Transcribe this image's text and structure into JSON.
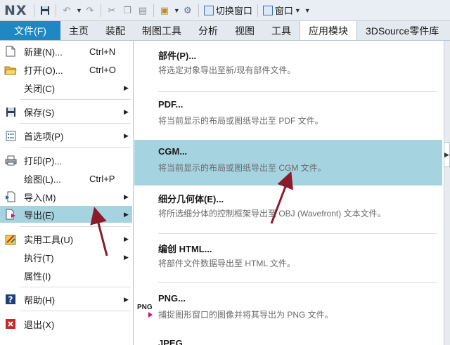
{
  "app": {
    "logo": "NX"
  },
  "quick_access": {
    "switch_window_label": "切换窗口",
    "window_label": "窗口",
    "icons": [
      "save-icon",
      "undo-icon",
      "redo-icon",
      "cut-icon",
      "copy-icon",
      "paste-icon",
      "touch-mode-icon",
      "repeat-command-icon"
    ]
  },
  "tabs": {
    "file": "文件(F)",
    "items": [
      "主页",
      "装配",
      "制图工具",
      "分析",
      "视图",
      "工具",
      "应用模块",
      "3DSource零件库"
    ],
    "active": "应用模块"
  },
  "left_menu": {
    "items": [
      {
        "label": "新建(N)...",
        "shortcut": "Ctrl+N",
        "icon": "new-icon",
        "arrow": false
      },
      {
        "label": "打开(O)...",
        "shortcut": "Ctrl+O",
        "icon": "open-folder-icon",
        "arrow": false
      },
      {
        "label": "关闭(C)",
        "shortcut": "",
        "icon": "",
        "arrow": true
      },
      {
        "label": "保存(S)",
        "shortcut": "",
        "icon": "save-icon",
        "arrow": true
      },
      {
        "label": "首选项(P)",
        "shortcut": "",
        "icon": "preferences-icon",
        "arrow": true
      },
      {
        "label": "打印(P)...",
        "shortcut": "",
        "icon": "print-icon",
        "arrow": false
      },
      {
        "label": "绘图(L)...",
        "shortcut": "Ctrl+P",
        "icon": "",
        "arrow": false
      },
      {
        "label": "导入(M)",
        "shortcut": "",
        "icon": "import-icon",
        "arrow": true
      },
      {
        "label": "导出(E)",
        "shortcut": "",
        "icon": "export-icon",
        "arrow": true
      },
      {
        "label": "实用工具(U)",
        "shortcut": "",
        "icon": "utilities-icon",
        "arrow": true
      },
      {
        "label": "执行(T)",
        "shortcut": "",
        "icon": "",
        "arrow": true
      },
      {
        "label": "属性(I)",
        "shortcut": "",
        "icon": "",
        "arrow": false
      },
      {
        "label": "帮助(H)",
        "shortcut": "",
        "icon": "help-icon",
        "arrow": true
      },
      {
        "label": "退出(X)",
        "shortcut": "",
        "icon": "exit-icon",
        "arrow": false
      }
    ],
    "highlighted": "导出(E)"
  },
  "export_menu": {
    "items": [
      {
        "title": "部件(P)...",
        "desc": "将选定对象导出至新/现有部件文件。"
      },
      {
        "title": "PDF...",
        "desc": "将当前显示的布局或图纸导出至 PDF 文件。"
      },
      {
        "title": "CGM...",
        "desc": "将当前显示的布局或图纸导出至 CGM 文件。"
      },
      {
        "title": "细分几何体(E)...",
        "desc": "将所选细分体的控制框架导出至 OBJ (Wavefront) 文本文件。"
      },
      {
        "title": "编创 HTML...",
        "desc": "将部件文件数据导出至 HTML 文件。"
      },
      {
        "title": "PNG...",
        "desc": "捕捉图形窗口的图像并将其导出为 PNG 文件。",
        "icon_text": "PNG"
      },
      {
        "title": "JPEG...",
        "desc": ""
      }
    ],
    "highlighted": "CGM..."
  },
  "colors": {
    "file_tab": "#1f87c2",
    "highlight": "#a6d3e0",
    "annotation_arrow": "#8b1a2b"
  }
}
